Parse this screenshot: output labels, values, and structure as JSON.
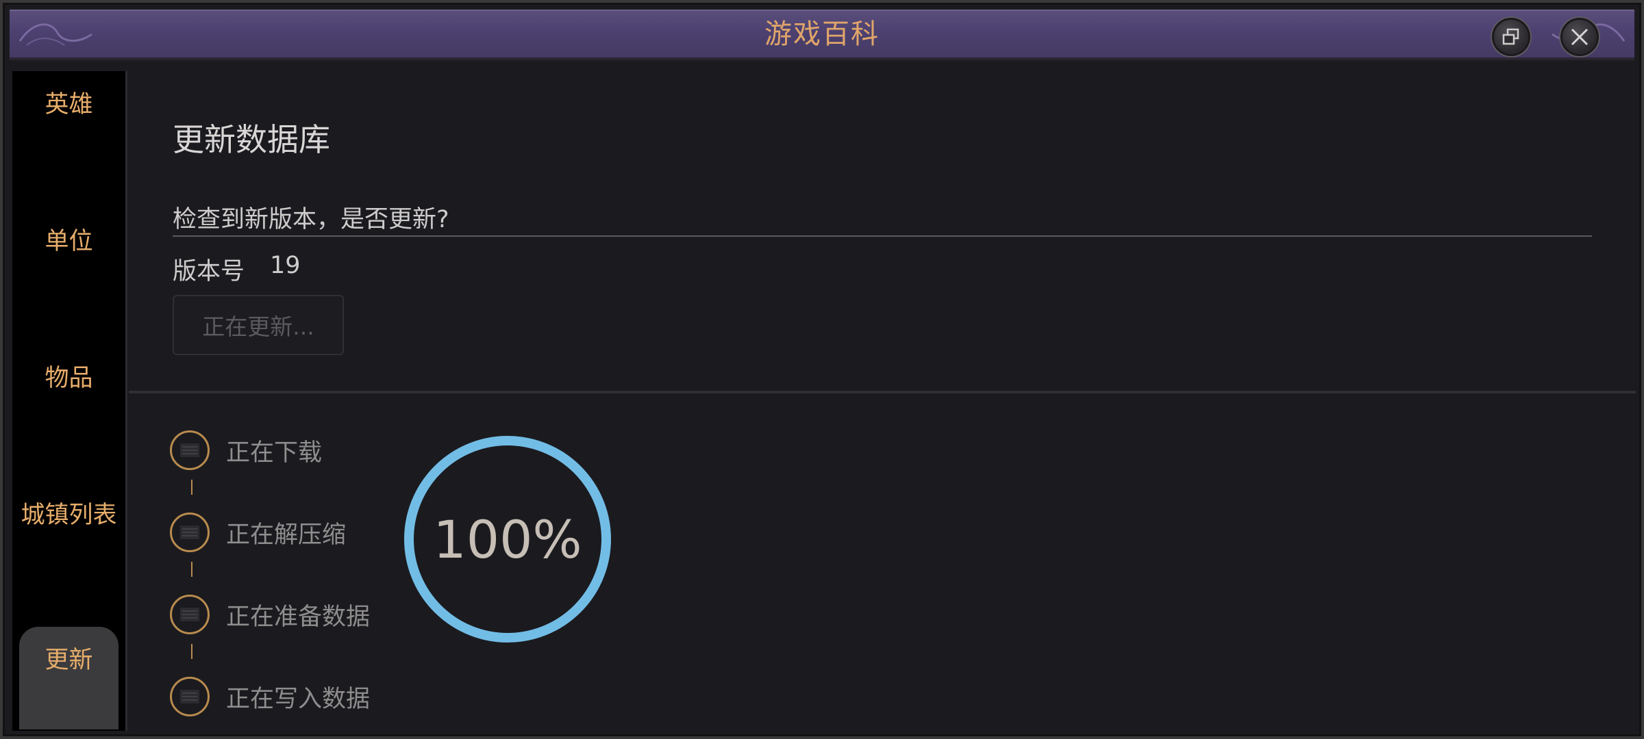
{
  "window": {
    "title": "游戏百科",
    "title_color": "#e0a56a",
    "accent_color": "#e7ad6b"
  },
  "sidebar": {
    "items": [
      {
        "label": "英雄",
        "active": false
      },
      {
        "label": "单位",
        "active": false
      },
      {
        "label": "物品",
        "active": false
      },
      {
        "label": "城镇列表",
        "active": false
      },
      {
        "label": "更新",
        "active": true
      }
    ]
  },
  "update": {
    "page_title": "更新数据库",
    "question": "检查到新版本，是否更新?",
    "version_label": "版本号",
    "version_value": "19",
    "button_label": "正在更新..."
  },
  "steps": [
    {
      "label": "正在下载"
    },
    {
      "label": "正在解压缩"
    },
    {
      "label": "正在准备数据"
    },
    {
      "label": "正在写入数据"
    }
  ],
  "progress": {
    "text": "100%",
    "fraction": 1.0,
    "color": "#72bde6"
  },
  "icons": {
    "restore": "restore-icon",
    "close": "close-icon",
    "step": "document-icon"
  }
}
